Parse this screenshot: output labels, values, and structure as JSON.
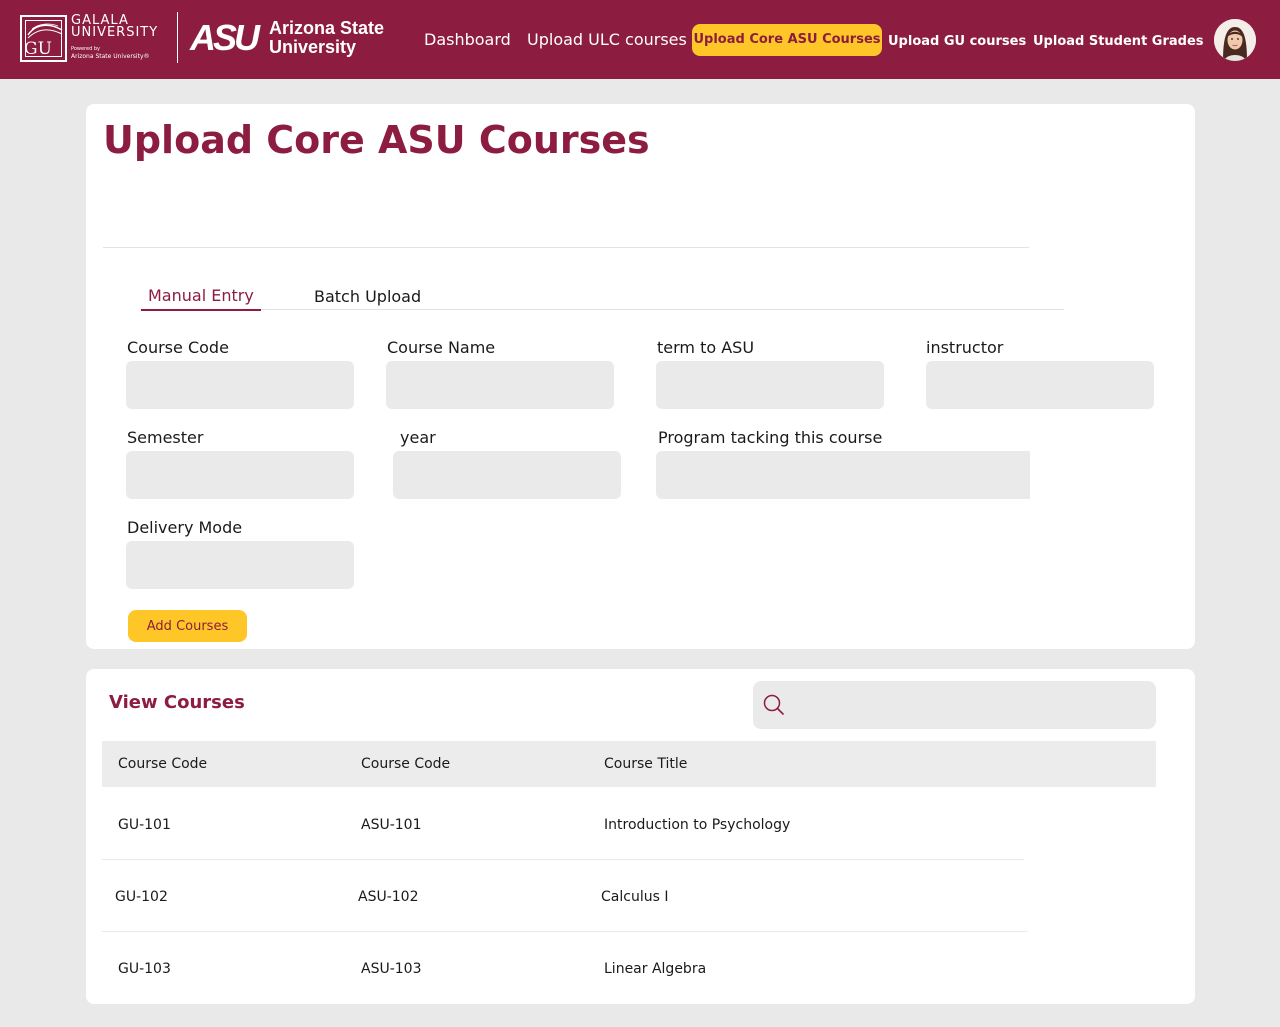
{
  "header": {
    "gu_logo": {
      "letters": "GU",
      "name_line1": "GALALA",
      "name_line2": "UNIVERSITY",
      "powered": "Powered by",
      "partner": "Arizona State University®"
    },
    "asu_logo": {
      "mark": "ASU",
      "name_line1": "Arizona State",
      "name_line2": "University"
    },
    "nav": [
      {
        "label": "Dashboard"
      },
      {
        "label": "Upload ULC courses"
      },
      {
        "label": "Upload Core ASU Courses",
        "active": true
      },
      {
        "label": "Upload GU courses"
      },
      {
        "label": "Upload Student Grades"
      }
    ]
  },
  "page": {
    "title": "Upload Core ASU Courses"
  },
  "tabs": [
    {
      "label": "Manual Entry",
      "active": true
    },
    {
      "label": "Batch Upload"
    }
  ],
  "form": {
    "fields": {
      "course_code": {
        "label": "Course Code",
        "value": ""
      },
      "course_name": {
        "label": "Course Name",
        "value": ""
      },
      "term_to_asu": {
        "label": "term to ASU",
        "value": ""
      },
      "instructor": {
        "label": "instructor",
        "value": ""
      },
      "semester": {
        "label": "Semester",
        "value": ""
      },
      "year": {
        "label": "year",
        "value": ""
      },
      "program": {
        "label": "Program tacking this course",
        "value": ""
      },
      "delivery_mode": {
        "label": "Delivery Mode",
        "value": ""
      }
    },
    "submit_label": "Add Courses"
  },
  "view": {
    "title": "View Courses",
    "search": {
      "value": "",
      "icon": "search-icon"
    },
    "columns": [
      "Course Code",
      "Course Code",
      "Course Title"
    ],
    "rows": [
      [
        "GU-101",
        "ASU-101",
        "Introduction to Psychology"
      ],
      [
        "GU-102",
        "ASU-102",
        "Calculus I"
      ],
      [
        "GU-103",
        "ASU-103",
        "Linear Algebra"
      ]
    ]
  },
  "colors": {
    "brand_maroon": "#8c1d40",
    "brand_gold": "#ffc627",
    "background": "#e9e9e9",
    "input_fill": "#eaeaea"
  }
}
